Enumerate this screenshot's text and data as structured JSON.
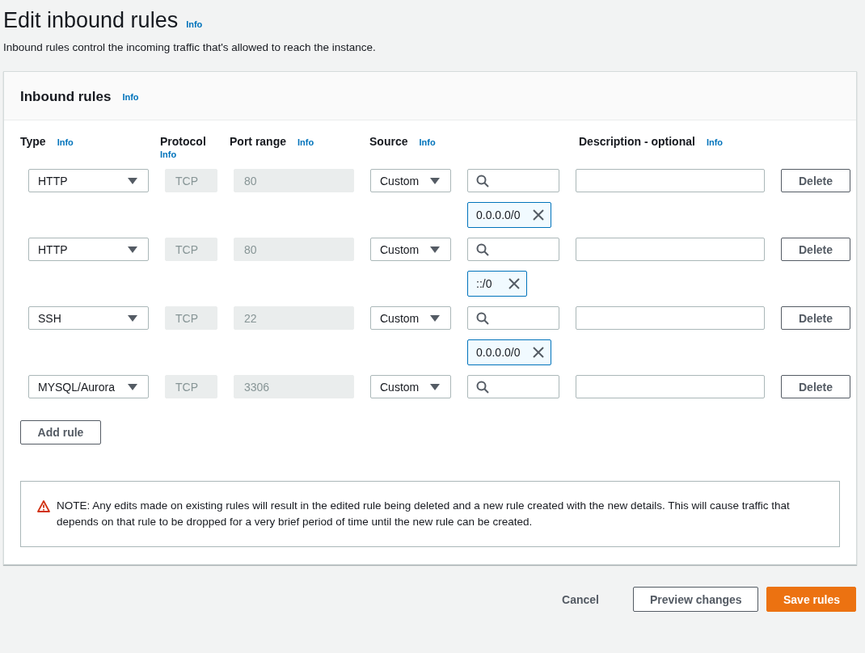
{
  "page": {
    "title": "Edit inbound rules",
    "title_info": "Info",
    "description": "Inbound rules control the incoming traffic that's allowed to reach the instance."
  },
  "card": {
    "title": "Inbound rules",
    "title_info": "Info",
    "columns": [
      {
        "label": "Type",
        "info": "Info"
      },
      {
        "label": "Protocol",
        "info": "Info"
      },
      {
        "label": "Port range",
        "info": "Info"
      },
      {
        "label": "Source",
        "info": "Info"
      },
      {
        "label": "Description - optional",
        "info": "Info"
      }
    ],
    "rules": [
      {
        "type": "HTTP",
        "protocol": {
          "value": "TCP",
          "disabled": true
        },
        "port_range": {
          "value": "80",
          "disabled": true
        },
        "source": "Custom",
        "chips": [
          "0.0.0.0/0"
        ],
        "delete": "Delete"
      },
      {
        "type": "HTTP",
        "protocol": {
          "value": "TCP",
          "disabled": true
        },
        "port_range": {
          "value": "80",
          "disabled": true
        },
        "source": "Custom",
        "chips": [
          "::/0"
        ],
        "delete": "Delete"
      },
      {
        "type": "SSH",
        "protocol": {
          "value": "TCP",
          "disabled": true
        },
        "port_range": {
          "value": "22",
          "disabled": true
        },
        "source": "Custom",
        "chips": [
          "0.0.0.0/0"
        ],
        "delete": "Delete"
      },
      {
        "type": "MYSQL/Aurora",
        "protocol": {
          "value": "TCP",
          "disabled": true
        },
        "port_range": {
          "value": "3306",
          "disabled": true
        },
        "source": "Custom",
        "delete": "Delete"
      }
    ],
    "add_rule": "Add rule",
    "note": "NOTE: Any edits made on existing rules will result in the edited rule being deleted and a new rule created with the new details. This will cause traffic that depends on that rule to be dropped for a very brief period of time until the new rule can be created."
  },
  "footer": {
    "cancel": "Cancel",
    "preview": "Preview changes",
    "save": "Save rules"
  }
}
